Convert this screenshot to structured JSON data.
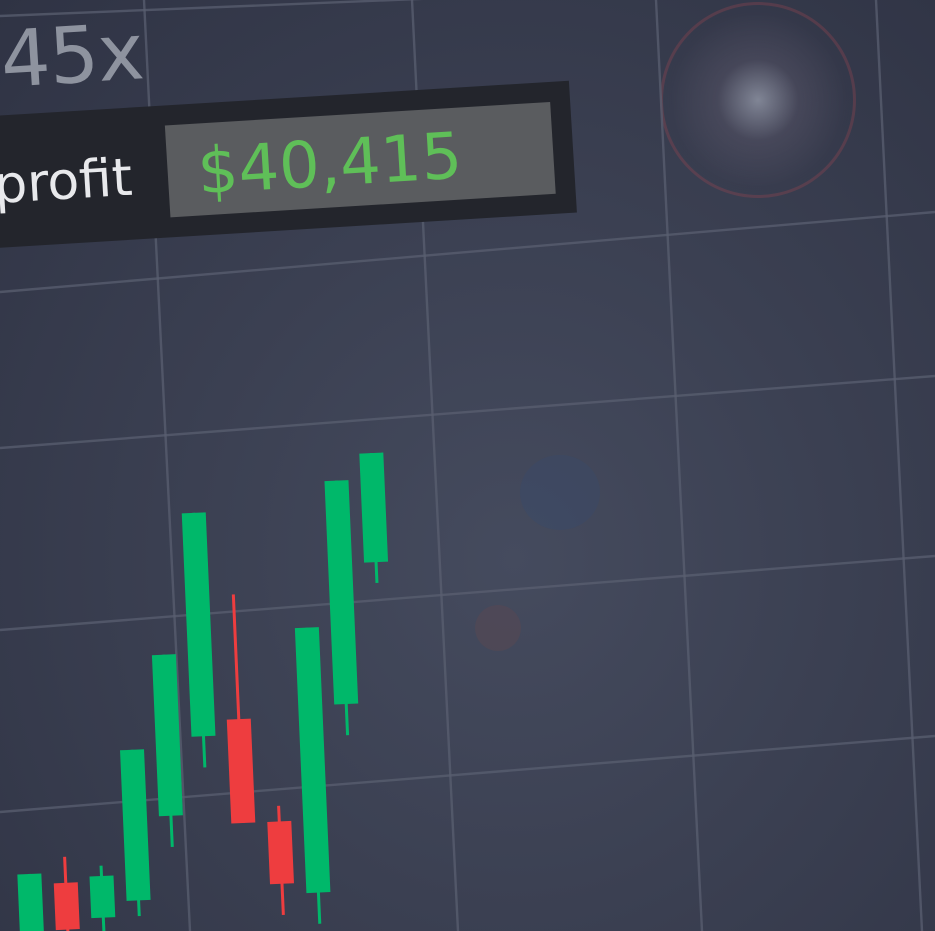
{
  "multiplier": "45x",
  "profit": {
    "label": "profit",
    "value": "$40,415"
  },
  "colors": {
    "background": "#3b4052",
    "grid": "#5a5f70",
    "up": "#00b86a",
    "down": "#ee3d3f",
    "profit_value": "#5fbf58"
  },
  "chart_data": {
    "type": "candlestick",
    "title": "",
    "xlabel": "",
    "ylabel": "",
    "grid": true,
    "ylim": [
      0,
      100
    ],
    "candles": [
      {
        "open": 2,
        "close": 15,
        "high": 15,
        "low": 2,
        "direction": "up"
      },
      {
        "open": 13,
        "close": 4,
        "high": 18,
        "low": 0,
        "direction": "down"
      },
      {
        "open": 6,
        "close": 14,
        "high": 16,
        "low": 3,
        "direction": "up"
      },
      {
        "open": 9,
        "close": 38,
        "high": 38,
        "low": 6,
        "direction": "up"
      },
      {
        "open": 25,
        "close": 56,
        "high": 56,
        "low": 19,
        "direction": "up"
      },
      {
        "open": 40,
        "close": 83,
        "high": 83,
        "low": 34,
        "direction": "up"
      },
      {
        "open": 43,
        "close": 23,
        "high": 67,
        "low": 23,
        "direction": "down"
      },
      {
        "open": 23,
        "close": 11,
        "high": 26,
        "low": 5,
        "direction": "down"
      },
      {
        "open": 9,
        "close": 60,
        "high": 60,
        "low": 3,
        "direction": "up"
      },
      {
        "open": 45,
        "close": 88,
        "high": 88,
        "low": 39,
        "direction": "up"
      },
      {
        "open": 72,
        "close": 93,
        "high": 93,
        "low": 68,
        "direction": "up"
      }
    ]
  }
}
